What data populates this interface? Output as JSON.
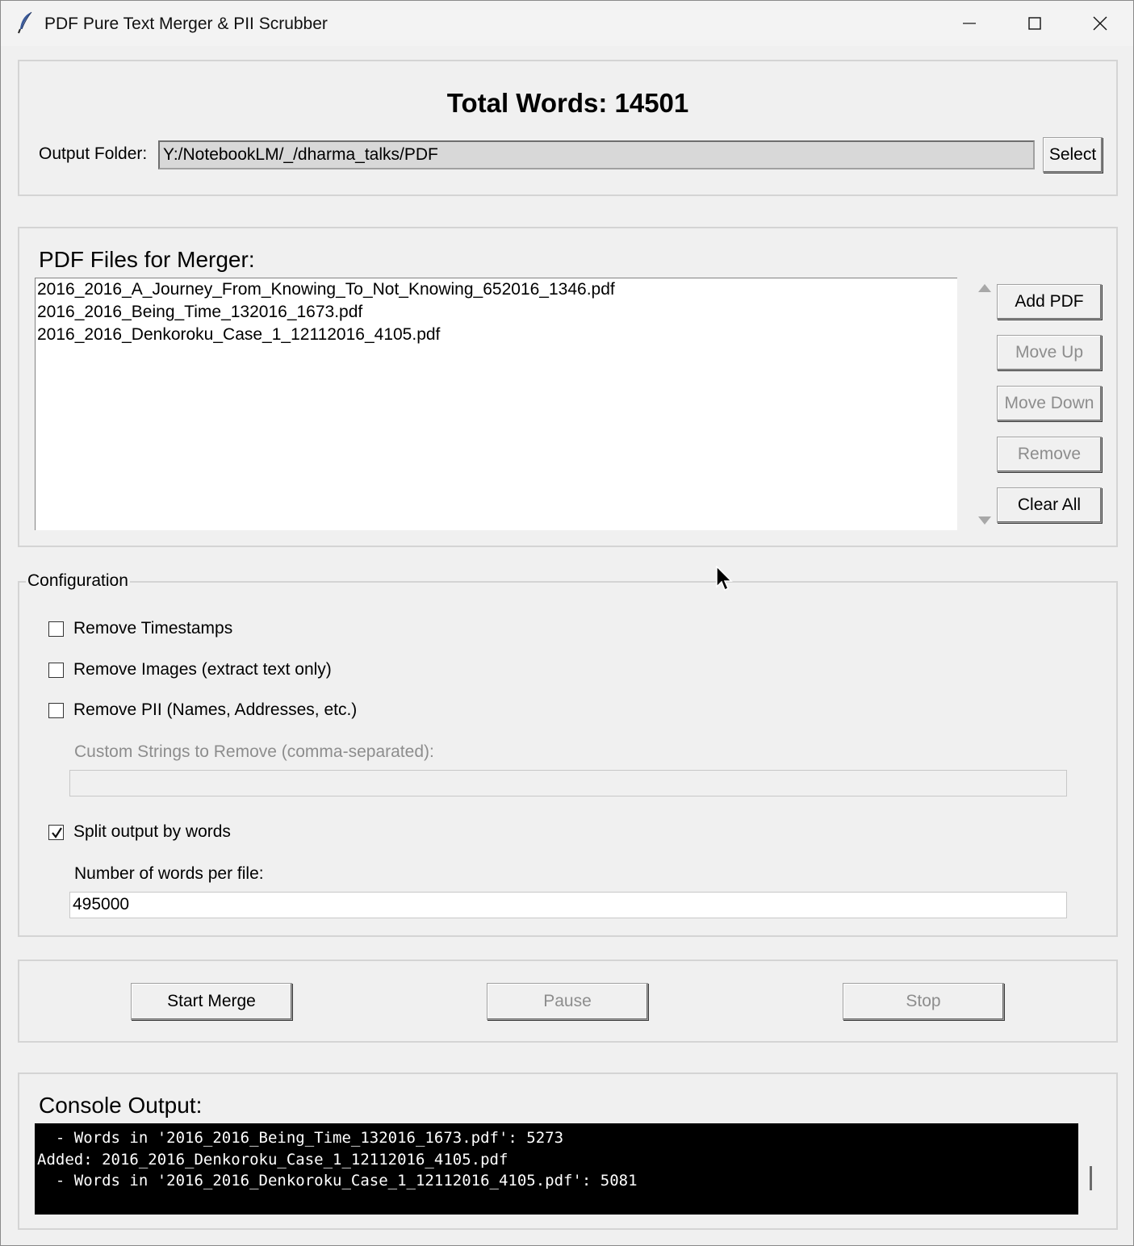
{
  "window": {
    "title": "PDF Pure Text Merger & PII Scrubber",
    "icons": [
      "feather-icon",
      "minimize-icon",
      "maximize-icon",
      "close-icon"
    ]
  },
  "header": {
    "total_words": "Total Words: 14501",
    "output_folder_label": "Output Folder:",
    "output_folder_value": "Y:/NotebookLM/_/dharma_talks/PDF",
    "select_label": "Select"
  },
  "files": {
    "title": "PDF Files for Merger:",
    "items": [
      "2016_2016_A_Journey_From_Knowing_To_Not_Knowing_652016_1346.pdf",
      "2016_2016_Being_Time_132016_1673.pdf",
      "2016_2016_Denkoroku_Case_1_12112016_4105.pdf"
    ],
    "buttons": {
      "add": "Add PDF",
      "move_up": "Move Up",
      "move_down": "Move Down",
      "remove": "Remove",
      "clear_all": "Clear All"
    }
  },
  "config": {
    "legend": "Configuration",
    "remove_timestamps": {
      "label": "Remove Timestamps",
      "checked": false
    },
    "remove_images": {
      "label": "Remove Images (extract text only)",
      "checked": false
    },
    "remove_pii": {
      "label": "Remove PII (Names, Addresses, etc.)",
      "checked": false
    },
    "custom_strings_label": "Custom Strings to Remove (comma-separated):",
    "custom_strings_value": "",
    "split_output": {
      "label": "Split output by words",
      "checked": true
    },
    "words_per_file_label": "Number of words per file:",
    "words_per_file_value": "495000"
  },
  "actions": {
    "start": "Start Merge",
    "pause": "Pause",
    "stop": "Stop"
  },
  "console": {
    "title": "Console Output:",
    "lines": [
      "  - Words in '2016_2016_Being_Time_132016_1673.pdf': 5273",
      "Added: 2016_2016_Denkoroku_Case_1_12112016_4105.pdf",
      "  - Words in '2016_2016_Denkoroku_Case_1_12112016_4105.pdf': 5081"
    ]
  }
}
